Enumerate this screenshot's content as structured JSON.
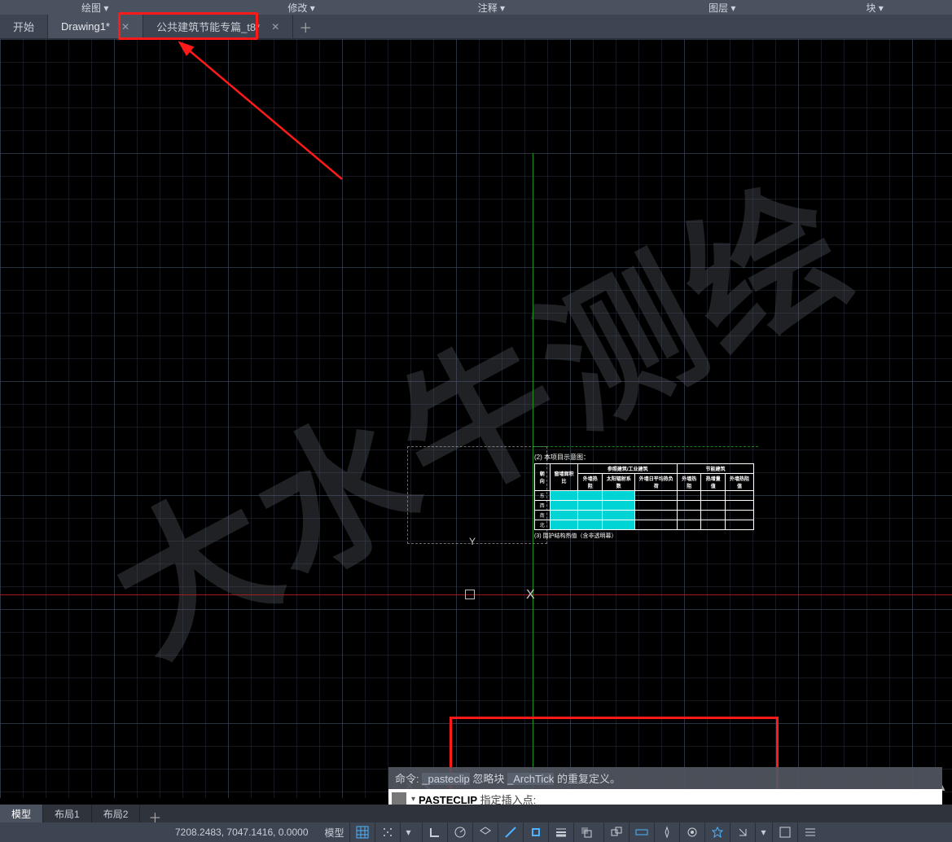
{
  "ribbon": {
    "draw": "绘图 ▾",
    "modify": "修改 ▾",
    "annotate": "注释 ▾",
    "layers": "图层 ▾",
    "block": "块 ▾"
  },
  "tabs": {
    "start": "开始",
    "active": "Drawing1*",
    "other": "公共建筑节能专篇_t8*"
  },
  "watermark": "大水牛测绘",
  "ucs": {
    "y": "Y",
    "x": "X"
  },
  "paste_preview": {
    "title": "(2) 本项目示意图：",
    "headers": [
      "朝向",
      "窗墙面积比",
      "参照建筑/工业建筑",
      "",
      "",
      "节能建筑",
      "",
      ""
    ],
    "subheaders": [
      "",
      "",
      "外墙热阻",
      "太阳辐射系数",
      "外墙日平均热负荷",
      "外墙热阻",
      "热增量值",
      "外墙热阻值"
    ],
    "rows": [
      "东",
      "西",
      "南",
      "北"
    ],
    "footer": "(3) 围护结构热值（含非透明幕）"
  },
  "command": {
    "history_prefix": "命令: ",
    "history_cmd": "_pasteclip",
    "history_mid": " 忽略块 ",
    "history_block": "_ArchTick",
    "history_suffix": " 的重复定义。",
    "active_cmd": "PASTECLIP",
    "prompt": " 指定插入点:"
  },
  "layout_tabs": {
    "model": "模型",
    "l1": "布局1",
    "l2": "布局2"
  },
  "status": {
    "coords": "7208.2483, 7047.1416, 0.0000",
    "model": "模型"
  }
}
